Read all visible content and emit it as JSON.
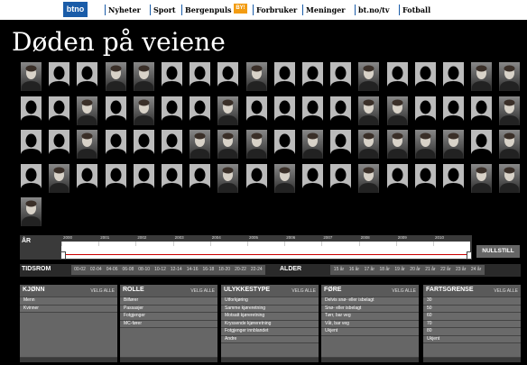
{
  "nav": {
    "logo": "btno",
    "items": [
      "Nyheter",
      "Sport",
      "Bergenpuls",
      "Forbruker",
      "Meninger",
      "bt.no/tv",
      "Fotball"
    ],
    "badge": "BY!"
  },
  "title": "Døden på veiene",
  "portraits": {
    "rows": [
      [
        1,
        0,
        0,
        1,
        1,
        0,
        0,
        0,
        1,
        0,
        0,
        0,
        1,
        0,
        0,
        0,
        1,
        1
      ],
      [
        0,
        0,
        1,
        0,
        1,
        0,
        0,
        1,
        0,
        0,
        0,
        0,
        1,
        1,
        0,
        0,
        0,
        1
      ],
      [
        0,
        0,
        1,
        0,
        0,
        0,
        1,
        1,
        1,
        0,
        1,
        0,
        1,
        1,
        1,
        1,
        0,
        1
      ],
      [
        0,
        1,
        0,
        0,
        0,
        0,
        0,
        1,
        0,
        1,
        0,
        0,
        1,
        0,
        0,
        0,
        1,
        1
      ],
      [
        1
      ]
    ]
  },
  "timeline": {
    "label": "ÅR",
    "years": [
      "2000",
      "2001",
      "2002",
      "2003",
      "2004",
      "2005",
      "2006",
      "2007",
      "2008",
      "2009",
      "2010"
    ],
    "reset": "NULLSTILL"
  },
  "tidsrom": {
    "label": "TIDSROM",
    "items": [
      "00-02",
      "02-04",
      "04-06",
      "06-08",
      "08-10",
      "10-12",
      "12-14",
      "14-16",
      "16-18",
      "18-20",
      "20-22",
      "22-24"
    ]
  },
  "alder": {
    "label": "ALDER",
    "items": [
      "15 år",
      "16 år",
      "17 år",
      "18 år",
      "19 år",
      "20 år",
      "21 år",
      "22 år",
      "23 år",
      "24 år"
    ]
  },
  "filters": [
    {
      "title": "KJØNN",
      "velg": "VELG ALLE",
      "items": [
        "Menn",
        "Kvinner"
      ]
    },
    {
      "title": "ROLLE",
      "velg": "VELG ALLE",
      "items": [
        "Bilfører",
        "Passasjer",
        "Fotgjenger",
        "MC-fører"
      ]
    },
    {
      "title": "ULYKKESTYPE",
      "velg": "VELG ALLE",
      "items": [
        "Utforkjøring",
        "Samme kjøreretning",
        "Motsatt kjøreretning",
        "Kryssende kjøreretning",
        "Fotgjenger innblandet",
        "Andre"
      ]
    },
    {
      "title": "FØRE",
      "velg": "VELG ALLE",
      "items": [
        "Delvis snø- eller isbelagt",
        "Snø- eller isbelagt",
        "Tørr, bar veg",
        "Våt, bar veg",
        "Ukjent"
      ]
    },
    {
      "title": "FARTSGRENSE",
      "velg": "VELG ALLE",
      "items": [
        "30",
        "50",
        "60",
        "70",
        "80",
        "Ukjent"
      ]
    }
  ]
}
